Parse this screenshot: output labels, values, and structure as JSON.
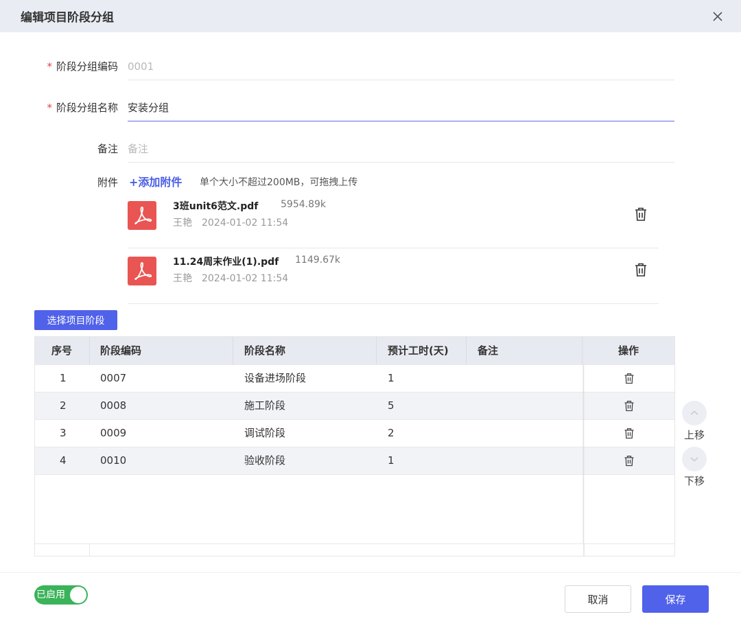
{
  "dialog": {
    "title": "编辑项目阶段分组"
  },
  "form": {
    "code": {
      "label": "阶段分组编码",
      "value": "0001"
    },
    "name": {
      "label": "阶段分组名称",
      "value": "安装分组"
    },
    "remark": {
      "label": "备注",
      "placeholder": "备注"
    },
    "attachment": {
      "label": "附件",
      "add_label": "+添加附件",
      "hint": "单个大小不超过200MB，可拖拽上传"
    }
  },
  "files": [
    {
      "name": "3班unit6范文.pdf",
      "size": "5954.89k",
      "uploader": "王艳",
      "time": "2024-01-02 11:54"
    },
    {
      "name": "11.24周末作业(1).pdf",
      "size": "1149.67k",
      "uploader": "王艳",
      "time": "2024-01-02 11:54"
    }
  ],
  "select_stage_button": "选择项目阶段",
  "table": {
    "headers": {
      "seq": "序号",
      "code": "阶段编码",
      "name": "阶段名称",
      "hours": "预计工时(天)",
      "remark": "备注",
      "op": "操作"
    },
    "rows": [
      {
        "seq": "1",
        "code": "0007",
        "name": "设备进场阶段",
        "hours": "1",
        "remark": ""
      },
      {
        "seq": "2",
        "code": "0008",
        "name": "施工阶段",
        "hours": "5",
        "remark": ""
      },
      {
        "seq": "3",
        "code": "0009",
        "name": "调试阶段",
        "hours": "2",
        "remark": ""
      },
      {
        "seq": "4",
        "code": "0010",
        "name": "验收阶段",
        "hours": "1",
        "remark": ""
      }
    ]
  },
  "move": {
    "up": "上移",
    "down": "下移"
  },
  "footer": {
    "toggle_label": "已启用",
    "cancel": "取消",
    "save": "保存"
  },
  "colors": {
    "primary": "#5061ea",
    "danger": "#e54545",
    "toggle_on": "#3bb35a",
    "pdf": "#e95552"
  }
}
